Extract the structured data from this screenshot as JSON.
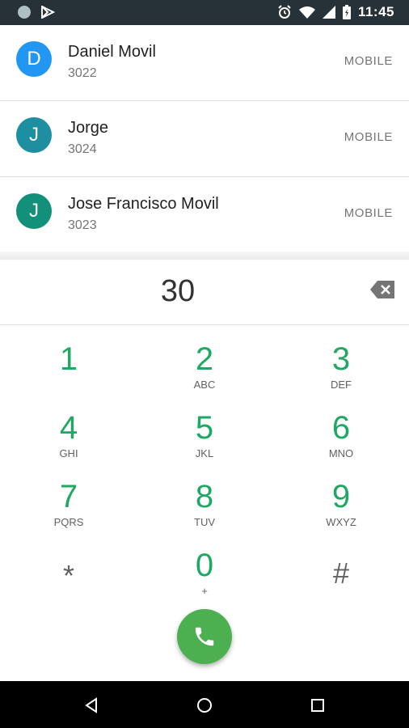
{
  "status_bar": {
    "time": "11:45",
    "icons": [
      "notification-dot-icon",
      "play-store-icon",
      "alarm-icon",
      "wifi-icon",
      "signal-icon",
      "battery-icon"
    ]
  },
  "contacts": [
    {
      "initial": "D",
      "name": "Daniel Movil",
      "number": "3022",
      "type": "MOBILE",
      "color": "#2196f3"
    },
    {
      "initial": "J",
      "name": "Jorge",
      "number": "3024",
      "type": "MOBILE",
      "color": "#1e8fa0"
    },
    {
      "initial": "J",
      "name": "Jose Francisco Movil",
      "number": "3023",
      "type": "MOBILE",
      "color": "#13907a"
    }
  ],
  "dialer": {
    "digits": "30",
    "accent_color": "#1fa862",
    "call_button_color": "#4caf50"
  },
  "keypad": [
    {
      "num": "1",
      "letters": ""
    },
    {
      "num": "2",
      "letters": "ABC"
    },
    {
      "num": "3",
      "letters": "DEF"
    },
    {
      "num": "4",
      "letters": "GHI"
    },
    {
      "num": "5",
      "letters": "JKL"
    },
    {
      "num": "6",
      "letters": "MNO"
    },
    {
      "num": "7",
      "letters": "PQRS"
    },
    {
      "num": "8",
      "letters": "TUV"
    },
    {
      "num": "9",
      "letters": "WXYZ"
    },
    {
      "num": "*",
      "letters": ""
    },
    {
      "num": "0",
      "letters": "+"
    },
    {
      "num": "#",
      "letters": ""
    }
  ]
}
